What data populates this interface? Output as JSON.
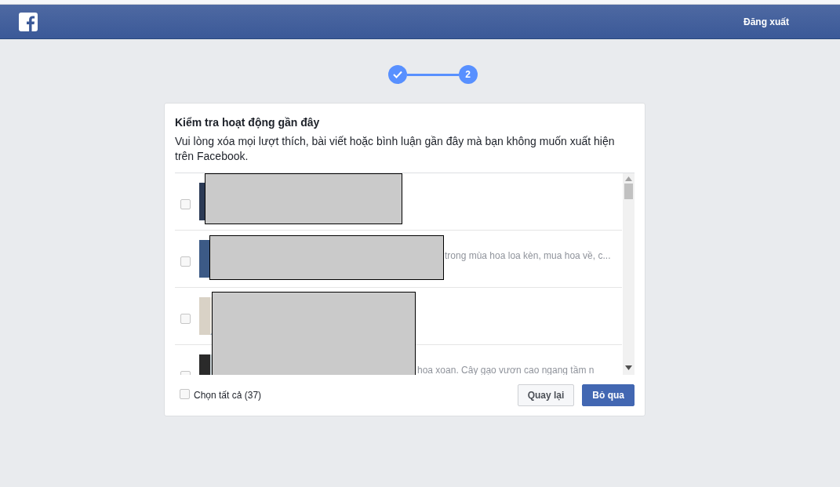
{
  "header": {
    "logout": "Đăng xuất"
  },
  "steps": [
    {
      "done": true
    },
    {
      "label": "2",
      "done": false
    }
  ],
  "dialog": {
    "title": "Kiểm tra hoạt động gần đây",
    "description": "Vui lòng xóa mọi lượt thích, bài viết hoặc bình luận gần đây mà bạn không muốn xuất hiện trên Facebook.",
    "items": [
      {
        "checked": false
      },
      {
        "checked": false,
        "snippet": "trong mùa hoa loa kèn, mua hoa về, c..."
      },
      {
        "checked": false
      },
      {
        "checked": false,
        "snippet": "hoa xoan. Cây gạo vươn cao ngang tầm n"
      }
    ],
    "select_all": {
      "label": "Chọn tất cả (37)",
      "checked": false
    },
    "buttons": [
      {
        "label": "Quay lại",
        "kind": "secondary"
      },
      {
        "label": "Bỏ qua",
        "kind": "primary"
      }
    ]
  }
}
